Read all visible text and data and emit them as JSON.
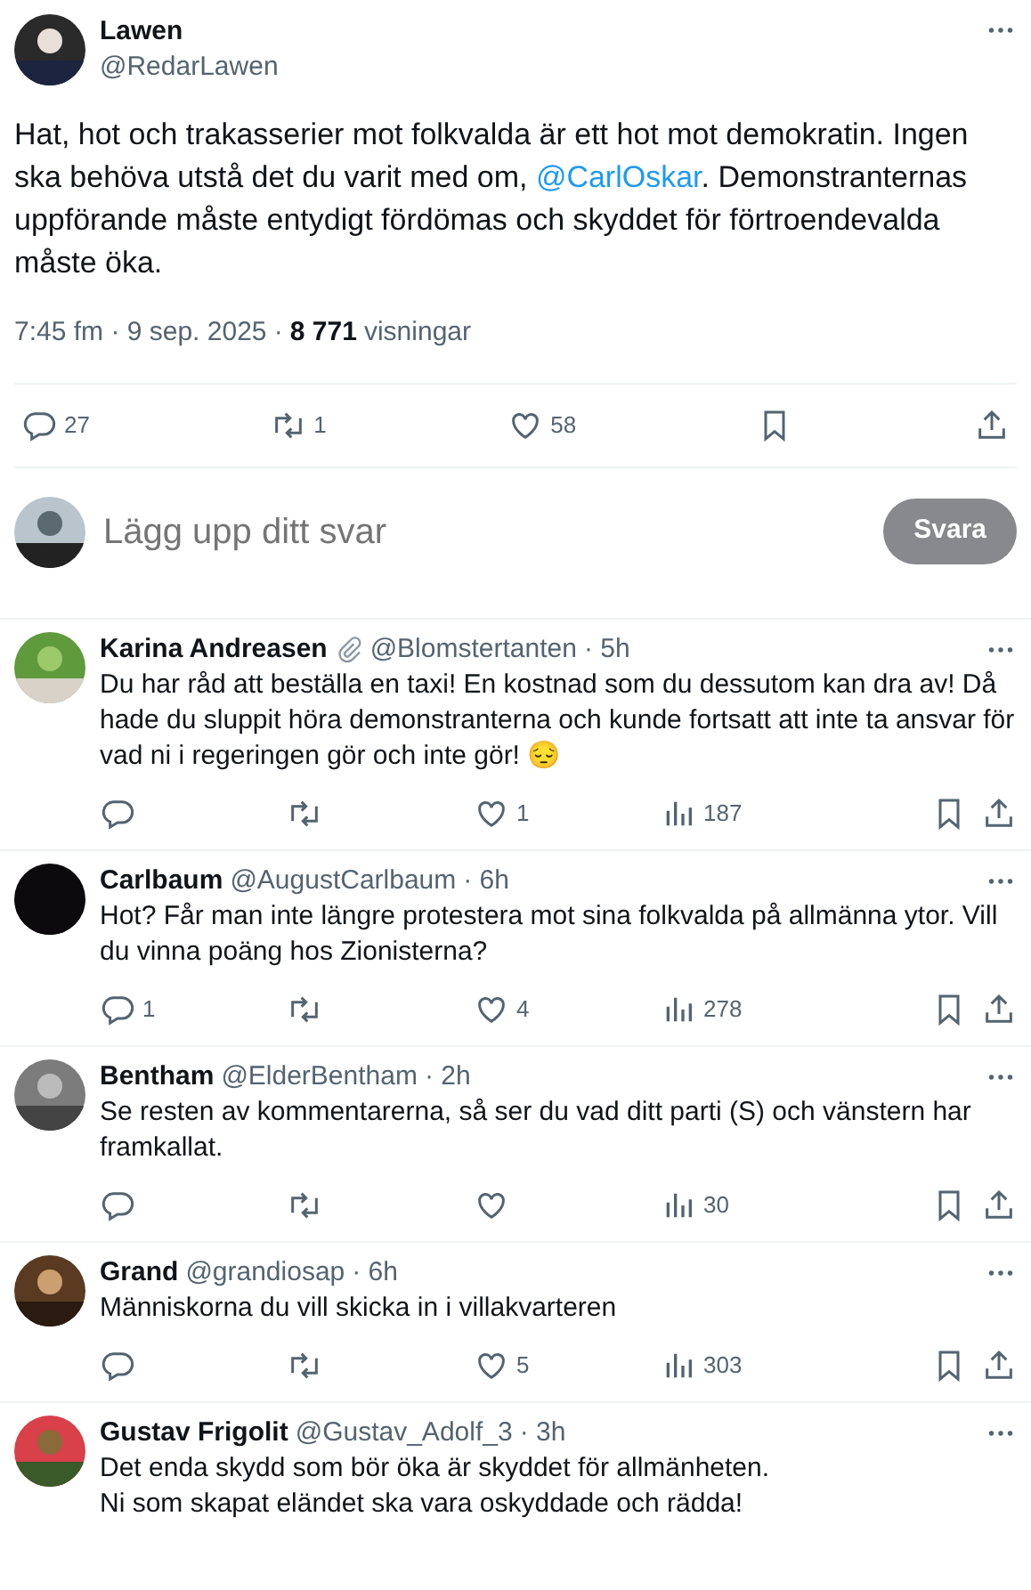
{
  "tweet": {
    "name": "Lawen",
    "handle": "@RedarLawen",
    "text": "Hat, hot och trakasserier mot folkvalda är ett hot mot demokratin. Ingen ska behöva utstå det du varit med om, ",
    "mention": "@CarlOskar",
    "text_after": ". Demonstranternas uppförande måste entydigt fördömas och skyddet för förtroendevalda måste öka.",
    "time": "7:45 fm · 9 sep. 2025 · ",
    "views": "8 771",
    "views_label": "visningar",
    "replies": "27",
    "retweets": "1",
    "likes": "58"
  },
  "composer": {
    "placeholder": "Lägg upp ditt svar",
    "button": "Svara"
  },
  "replies": [
    {
      "name": "Karina Andreasen",
      "badge": true,
      "handle": "@Blomstertanten",
      "time": "· 5h",
      "text": "Du har råd att beställa en taxi!  En kostnad som du dessutom kan dra av! Då hade du sluppit höra demonstranterna och kunde fortsatt att inte ta ansvar för vad ni i regeringen gör och inte gör! 😔",
      "likes": "1",
      "views": "187"
    },
    {
      "name": "Carlbaum",
      "badge": false,
      "handle": "@AugustCarlbaum",
      "time": "· 6h",
      "text": "Hot? Får man inte längre protestera mot sina folkvalda på allmänna ytor. Vill du vinna poäng hos Zionisterna?",
      "replies": "1",
      "likes": "4",
      "views": "278"
    },
    {
      "name": "Bentham",
      "badge": false,
      "handle": "@ElderBentham",
      "time": "· 2h",
      "text": "Se resten av kommentarerna, så ser du vad ditt parti (S) och vänstern har framkallat.",
      "views": "30"
    },
    {
      "name": "Grand",
      "badge": false,
      "handle": "@grandiosap",
      "time": "· 6h",
      "text": "Människorna du vill skicka in i villakvarteren",
      "likes": "5",
      "views": "303"
    },
    {
      "name": "Gustav Frigolit",
      "badge": false,
      "handle": "@Gustav_Adolf_3",
      "time": "· 3h",
      "text": "Det enda skydd som bör öka är skyddet för allmänheten.\nNi som skapat eländet ska vara oskyddade och rädda!"
    }
  ]
}
